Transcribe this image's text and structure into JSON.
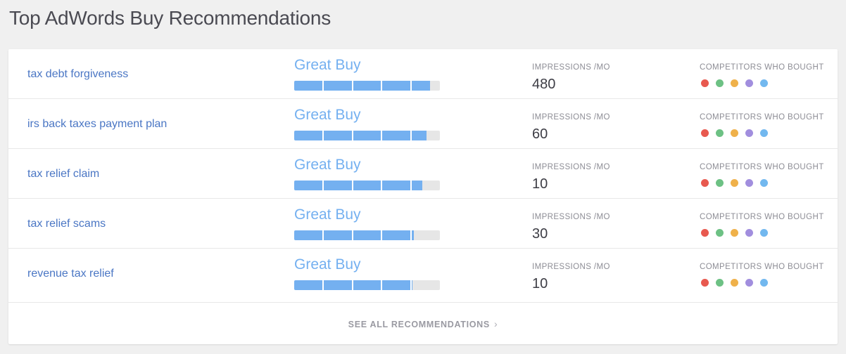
{
  "header": {
    "title": "Top AdWords Buy Recommendations"
  },
  "columns": {
    "impressions_label": "IMPRESSIONS /MO",
    "competitors_label": "COMPETITORS WHO BOUGHT"
  },
  "colors": {
    "page_background": "#f0f0f0",
    "card_background": "#ffffff",
    "keyword_link": "#4a76c4",
    "buy_accent": "#74b0f0",
    "bar_track": "#e6e6e6",
    "title": "#4a4a52",
    "column_header": "#8d8d95",
    "value": "#3d3d45",
    "footer_link": "#9a9aa2",
    "divider": "#e8e8e8"
  },
  "competitor_dot_colors": [
    "#e8594f",
    "#6dc184",
    "#efb14a",
    "#a18ede",
    "#72b8ef"
  ],
  "rows": [
    {
      "keyword": "tax debt forgiveness",
      "rating": "Great Buy",
      "bar_fill_percent": 93,
      "impressions": "480",
      "competitor_count": 5
    },
    {
      "keyword": "irs back taxes payment plan",
      "rating": "Great Buy",
      "bar_fill_percent": 91,
      "impressions": "60",
      "competitor_count": 5
    },
    {
      "keyword": "tax relief claim",
      "rating": "Great Buy",
      "bar_fill_percent": 88,
      "impressions": "10",
      "competitor_count": 5
    },
    {
      "keyword": "tax relief scams",
      "rating": "Great Buy",
      "bar_fill_percent": 82,
      "impressions": "30",
      "competitor_count": 5
    },
    {
      "keyword": "revenue tax relief",
      "rating": "Great Buy",
      "bar_fill_percent": 81,
      "impressions": "10",
      "competitor_count": 5
    }
  ],
  "footer": {
    "see_all_label": "SEE ALL RECOMMENDATIONS",
    "chevron": "›"
  }
}
